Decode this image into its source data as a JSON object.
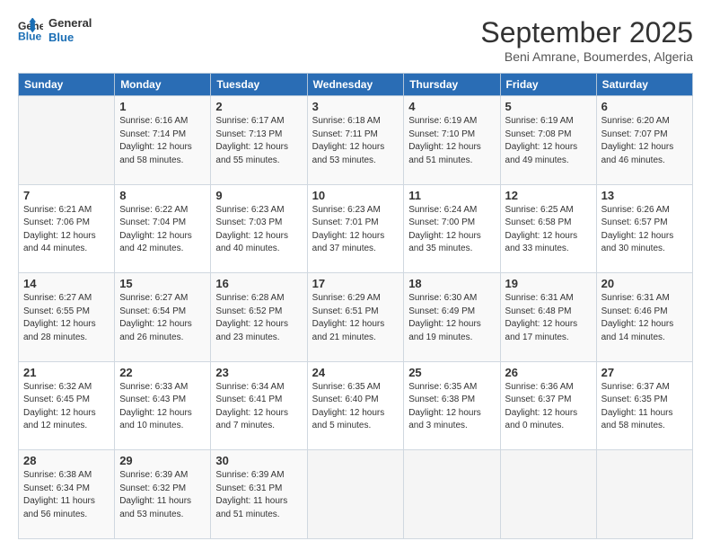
{
  "header": {
    "logo_line1": "General",
    "logo_line2": "Blue",
    "month": "September 2025",
    "location": "Beni Amrane, Boumerdes, Algeria"
  },
  "days_of_week": [
    "Sunday",
    "Monday",
    "Tuesday",
    "Wednesday",
    "Thursday",
    "Friday",
    "Saturday"
  ],
  "weeks": [
    [
      {
        "day": "",
        "text": ""
      },
      {
        "day": "1",
        "text": "Sunrise: 6:16 AM\nSunset: 7:14 PM\nDaylight: 12 hours\nand 58 minutes."
      },
      {
        "day": "2",
        "text": "Sunrise: 6:17 AM\nSunset: 7:13 PM\nDaylight: 12 hours\nand 55 minutes."
      },
      {
        "day": "3",
        "text": "Sunrise: 6:18 AM\nSunset: 7:11 PM\nDaylight: 12 hours\nand 53 minutes."
      },
      {
        "day": "4",
        "text": "Sunrise: 6:19 AM\nSunset: 7:10 PM\nDaylight: 12 hours\nand 51 minutes."
      },
      {
        "day": "5",
        "text": "Sunrise: 6:19 AM\nSunset: 7:08 PM\nDaylight: 12 hours\nand 49 minutes."
      },
      {
        "day": "6",
        "text": "Sunrise: 6:20 AM\nSunset: 7:07 PM\nDaylight: 12 hours\nand 46 minutes."
      }
    ],
    [
      {
        "day": "7",
        "text": "Sunrise: 6:21 AM\nSunset: 7:06 PM\nDaylight: 12 hours\nand 44 minutes."
      },
      {
        "day": "8",
        "text": "Sunrise: 6:22 AM\nSunset: 7:04 PM\nDaylight: 12 hours\nand 42 minutes."
      },
      {
        "day": "9",
        "text": "Sunrise: 6:23 AM\nSunset: 7:03 PM\nDaylight: 12 hours\nand 40 minutes."
      },
      {
        "day": "10",
        "text": "Sunrise: 6:23 AM\nSunset: 7:01 PM\nDaylight: 12 hours\nand 37 minutes."
      },
      {
        "day": "11",
        "text": "Sunrise: 6:24 AM\nSunset: 7:00 PM\nDaylight: 12 hours\nand 35 minutes."
      },
      {
        "day": "12",
        "text": "Sunrise: 6:25 AM\nSunset: 6:58 PM\nDaylight: 12 hours\nand 33 minutes."
      },
      {
        "day": "13",
        "text": "Sunrise: 6:26 AM\nSunset: 6:57 PM\nDaylight: 12 hours\nand 30 minutes."
      }
    ],
    [
      {
        "day": "14",
        "text": "Sunrise: 6:27 AM\nSunset: 6:55 PM\nDaylight: 12 hours\nand 28 minutes."
      },
      {
        "day": "15",
        "text": "Sunrise: 6:27 AM\nSunset: 6:54 PM\nDaylight: 12 hours\nand 26 minutes."
      },
      {
        "day": "16",
        "text": "Sunrise: 6:28 AM\nSunset: 6:52 PM\nDaylight: 12 hours\nand 23 minutes."
      },
      {
        "day": "17",
        "text": "Sunrise: 6:29 AM\nSunset: 6:51 PM\nDaylight: 12 hours\nand 21 minutes."
      },
      {
        "day": "18",
        "text": "Sunrise: 6:30 AM\nSunset: 6:49 PM\nDaylight: 12 hours\nand 19 minutes."
      },
      {
        "day": "19",
        "text": "Sunrise: 6:31 AM\nSunset: 6:48 PM\nDaylight: 12 hours\nand 17 minutes."
      },
      {
        "day": "20",
        "text": "Sunrise: 6:31 AM\nSunset: 6:46 PM\nDaylight: 12 hours\nand 14 minutes."
      }
    ],
    [
      {
        "day": "21",
        "text": "Sunrise: 6:32 AM\nSunset: 6:45 PM\nDaylight: 12 hours\nand 12 minutes."
      },
      {
        "day": "22",
        "text": "Sunrise: 6:33 AM\nSunset: 6:43 PM\nDaylight: 12 hours\nand 10 minutes."
      },
      {
        "day": "23",
        "text": "Sunrise: 6:34 AM\nSunset: 6:41 PM\nDaylight: 12 hours\nand 7 minutes."
      },
      {
        "day": "24",
        "text": "Sunrise: 6:35 AM\nSunset: 6:40 PM\nDaylight: 12 hours\nand 5 minutes."
      },
      {
        "day": "25",
        "text": "Sunrise: 6:35 AM\nSunset: 6:38 PM\nDaylight: 12 hours\nand 3 minutes."
      },
      {
        "day": "26",
        "text": "Sunrise: 6:36 AM\nSunset: 6:37 PM\nDaylight: 12 hours\nand 0 minutes."
      },
      {
        "day": "27",
        "text": "Sunrise: 6:37 AM\nSunset: 6:35 PM\nDaylight: 11 hours\nand 58 minutes."
      }
    ],
    [
      {
        "day": "28",
        "text": "Sunrise: 6:38 AM\nSunset: 6:34 PM\nDaylight: 11 hours\nand 56 minutes."
      },
      {
        "day": "29",
        "text": "Sunrise: 6:39 AM\nSunset: 6:32 PM\nDaylight: 11 hours\nand 53 minutes."
      },
      {
        "day": "30",
        "text": "Sunrise: 6:39 AM\nSunset: 6:31 PM\nDaylight: 11 hours\nand 51 minutes."
      },
      {
        "day": "",
        "text": ""
      },
      {
        "day": "",
        "text": ""
      },
      {
        "day": "",
        "text": ""
      },
      {
        "day": "",
        "text": ""
      }
    ]
  ]
}
